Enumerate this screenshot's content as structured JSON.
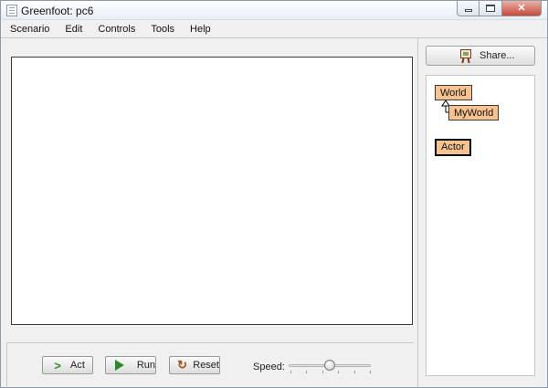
{
  "window": {
    "title": "Greenfoot: pc6",
    "controls": {
      "minimize": "minimize-icon",
      "maximize": "maximize-icon",
      "close": "close-icon",
      "close_glyph": "✕"
    }
  },
  "menubar": {
    "items": [
      "Scenario",
      "Edit",
      "Controls",
      "Tools",
      "Help"
    ]
  },
  "controls": {
    "act_label": "Act",
    "run_label": "Run",
    "reset_label": "Reset",
    "speed_label": "Speed:",
    "speed_value": 0.5,
    "icons": {
      "act": "step-arrow-icon",
      "run": "play-icon",
      "reset": "reset-icon"
    }
  },
  "sidebar": {
    "share_label": "Share...",
    "share_icon": "easel-icon",
    "classes": {
      "world": "World",
      "myworld": "MyWorld",
      "actor": "Actor"
    }
  },
  "colors": {
    "class_box": "#f6c28f",
    "run_green": "#2b8a2b",
    "reset_brown": "#a0521c",
    "close_red": "#c8493a"
  }
}
